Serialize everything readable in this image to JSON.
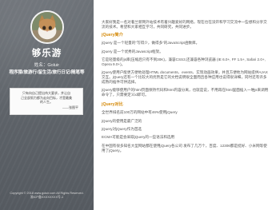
{
  "sidebar": {
    "site_title": "够乐游",
    "author_line": "姓名：Goluir",
    "tagline": "程序猿/旅游行/留生活/旅行日记/随笔等",
    "quote": {
      "lines": [
        "只有向自己提出伟大要求，并让自",
        "己全部努力都为走向目标，才是最美",
        "的人生。"
      ],
      "source": "——张图平"
    },
    "copyright": [
      "Copyright © 2018 www.goluir.com  All Rights Reserved.",
      "渝ICP备XXXXXXXX号-1"
    ]
  },
  "content": {
    "intro": "大家好我是一名对着兰新网外站技术有着兴趣爱好的网络，现在也在没开和学习交流中一些想和分享交流的技术。希望和大家相互学习，共同研究，共同进步。",
    "section1": {
      "heading": "jQuery简介",
      "paragraphs": [
        "jQuery 是一个轻量的\"写得少，做得多\"的JavaScript函数库。",
        "jQuery 是一个优秀的Javascript框架。",
        "它是轻量级的js库(压缩后只有不到30K)，兼容CSS3,还兼容各种浏览器 (IE 6.0+, FF 1.5+, Safari 2.0+, Opera 9.0+)。",
        "jQuery使用户能更方便地处理HTML documents、events、实现动画效果，并且方便地为网站提供AJAX交互。jQuery还有一个比较大的优势是它的文档说明很全面而且各种应用也说得很详细，同时还有许多成熟的插件可供选择。",
        "jQuery能够使用户的html页面保持代码和html内容分离，也就是说，不用再在html里面插入一堆js来调用命令了，只需要定义id即可。"
      ]
    },
    "section2": {
      "heading": "jQuery对比",
      "paragraphs": [
        "全世界排名前100万的网站中有46%使用jQuery",
        "jQuery的使用是最广泛的",
        "jQuery对jQuery作为首选",
        "ECMA可能是会采取jQuery的一些语法和选用",
        "在中国有很多知名大型网站都在使用jQuery各公司 发布了几万个，百度、12306都是挺好、小米网等使用了jQuery。"
      ]
    }
  }
}
